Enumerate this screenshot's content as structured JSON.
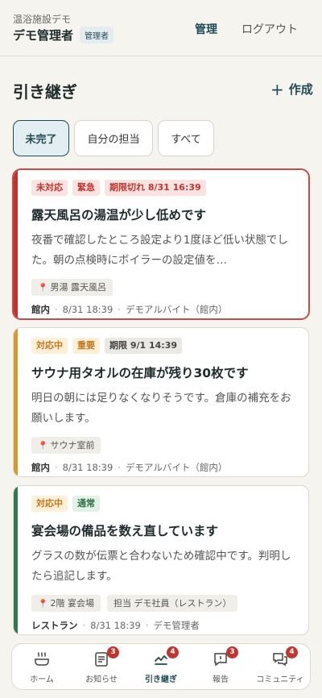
{
  "header": {
    "facility": "温浴施設デモ",
    "user_name": "デモ管理者",
    "role": "管理者",
    "nav_admin": "管理",
    "nav_logout": "ログアウト"
  },
  "page": {
    "title": "引き継ぎ",
    "create_label": "作成"
  },
  "filters": [
    {
      "label": "未完了",
      "active": true
    },
    {
      "label": "自分の担当",
      "active": false
    },
    {
      "label": "すべて",
      "active": false
    }
  ],
  "cards": [
    {
      "status": "未対応",
      "priority": "緊急",
      "deadline": "期限切れ 8/31 16:39",
      "title": "露天風呂の湯温が少し低めです",
      "body": "夜番で確認したところ設定より1度ほど低い状態でした。朝の点検時にボイラーの設定値を…",
      "location": "男湯 露天風呂",
      "assignee": "",
      "dept": "館内",
      "datetime": "8/31 18:39",
      "author": "デモアルバイト（館内）"
    },
    {
      "status": "対応中",
      "priority": "重要",
      "deadline": "期限 9/1 14:39",
      "title": "サウナ用タオルの在庫が残り30枚です",
      "body": "明日の朝には足りなくなりそうです。倉庫の補充をお願いします。",
      "location": "サウナ室前",
      "assignee": "",
      "dept": "館内",
      "datetime": "8/31 18:39",
      "author": "デモアルバイト（館内）"
    },
    {
      "status": "対応中",
      "priority": "通常",
      "deadline": "",
      "title": "宴会場の備品を数え直しています",
      "body": "グラスの数が伝票と合わないため確認中です。判明したら追記します。",
      "location": "2階 宴会場",
      "assignee": "担当 デモ社員（レストラン）",
      "dept": "レストラン",
      "datetime": "8/31 18:39",
      "author": "デモ管理者"
    }
  ],
  "bottom_nav": [
    {
      "label": "ホーム",
      "icon": "bath-icon",
      "count": null
    },
    {
      "label": "お知らせ",
      "icon": "notice-icon",
      "count": 3
    },
    {
      "label": "引き継ぎ",
      "icon": "handover-icon",
      "count": 4,
      "active": true
    },
    {
      "label": "報告",
      "icon": "report-icon",
      "count": 3
    },
    {
      "label": "コミュニティ",
      "icon": "community-icon",
      "count": 4
    }
  ]
}
